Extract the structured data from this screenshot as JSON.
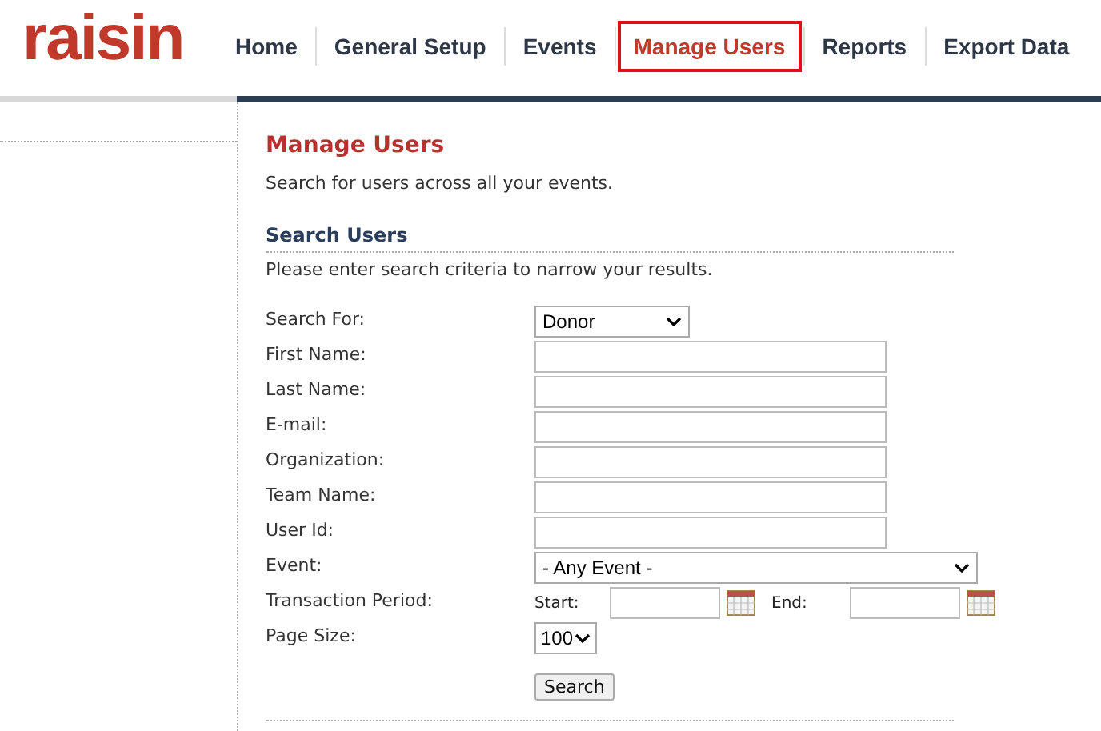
{
  "logo": "raisin",
  "nav": [
    {
      "label": "Home",
      "selected": false
    },
    {
      "label": "General Setup",
      "selected": false
    },
    {
      "label": "Events",
      "selected": false
    },
    {
      "label": "Manage Users",
      "selected": true
    },
    {
      "label": "Reports",
      "selected": false
    },
    {
      "label": "Export Data",
      "selected": false
    }
  ],
  "page": {
    "title": "Manage Users",
    "intro": "Search for users across all your events.",
    "section_title": "Search Users",
    "instruction": "Please enter search criteria to narrow your results.",
    "fields": [
      {
        "kind": "select",
        "label": "Search For:",
        "value": "Donor"
      },
      {
        "kind": "text",
        "label": "First Name:"
      },
      {
        "kind": "text",
        "label": "Last Name:"
      },
      {
        "kind": "text",
        "label": "E-mail:"
      },
      {
        "kind": "text",
        "label": "Organization:"
      },
      {
        "kind": "text",
        "label": "Team Name:"
      },
      {
        "kind": "text",
        "label": "User Id:"
      },
      {
        "kind": "wide_select",
        "label": "Event:",
        "value": "- Any Event -"
      },
      {
        "kind": "date_range",
        "label": "Transaction Period:",
        "start_label": "Start:",
        "end_label": "End:"
      },
      {
        "kind": "small_select",
        "label": "Page Size:",
        "value": "100"
      }
    ],
    "search_button": "Search"
  }
}
